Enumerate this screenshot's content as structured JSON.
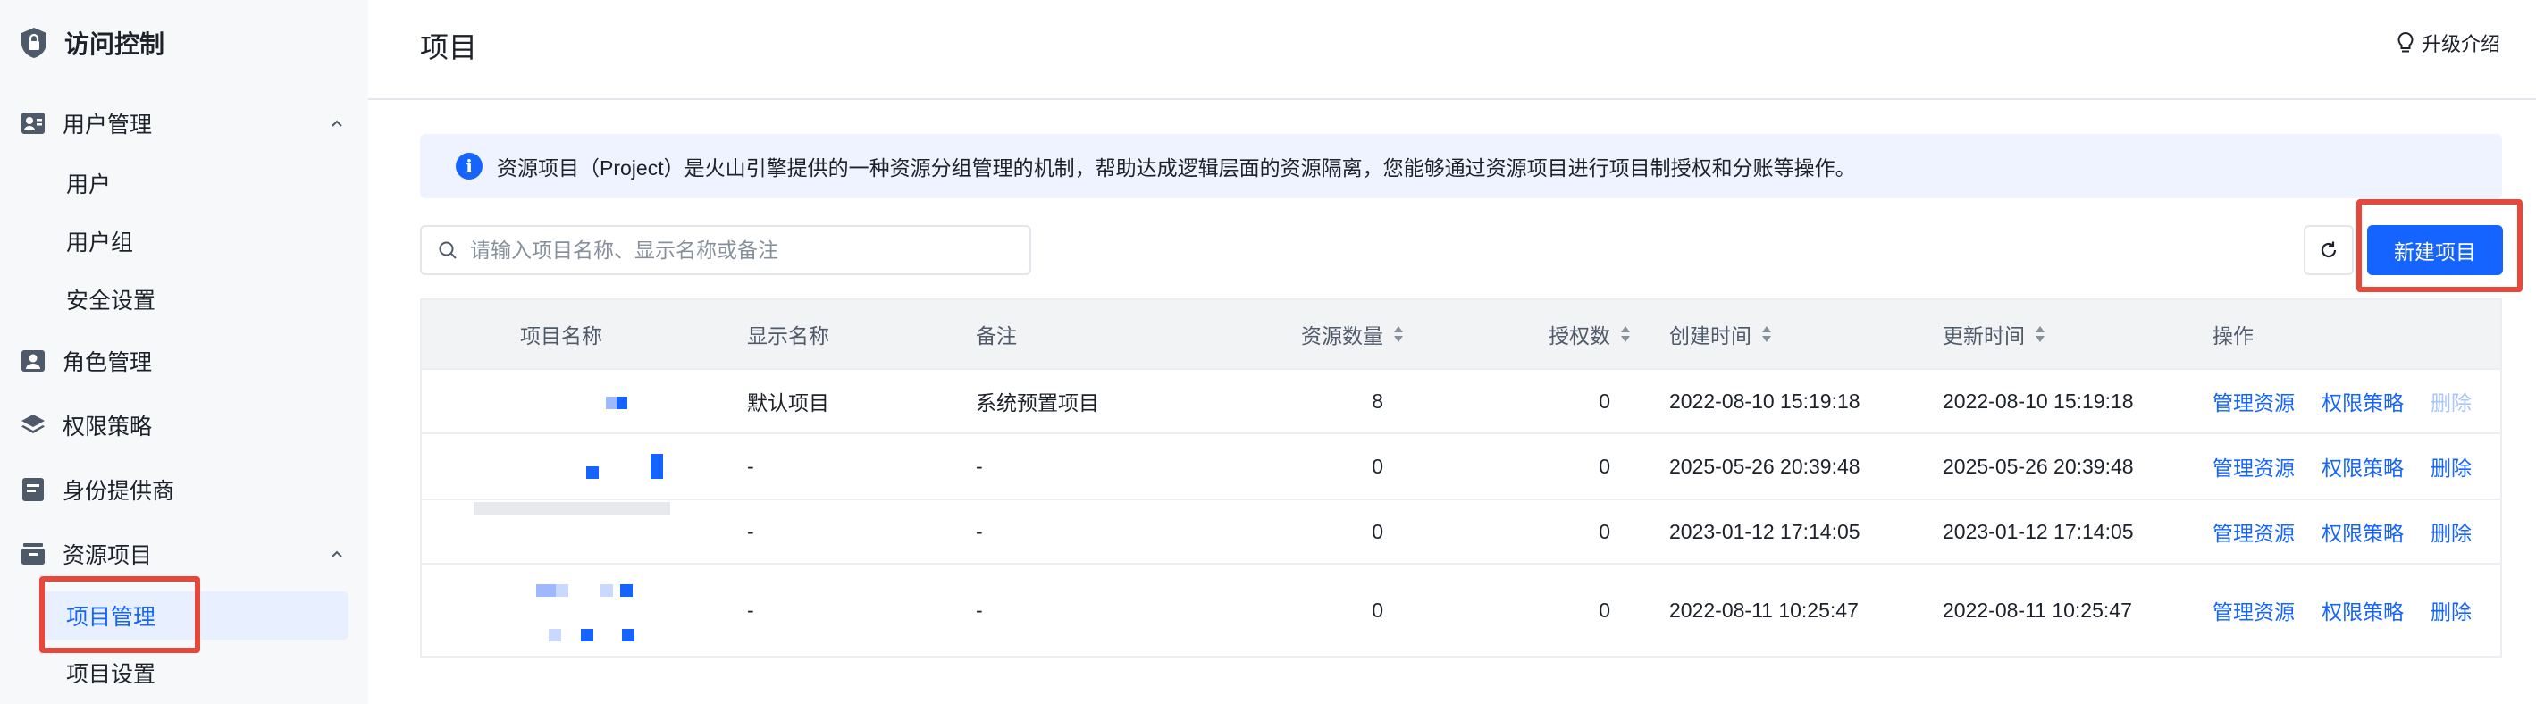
{
  "sidebar": {
    "title": "访问控制",
    "groups": [
      {
        "label": "用户管理",
        "children": [
          "用户",
          "用户组",
          "安全设置"
        ]
      },
      {
        "label": "角色管理"
      },
      {
        "label": "权限策略"
      },
      {
        "label": "身份提供商"
      },
      {
        "label": "资源项目",
        "children": [
          "项目管理",
          "项目设置"
        ]
      }
    ],
    "active_item": "项目管理"
  },
  "header": {
    "title": "项目",
    "upgrade_label": "升级介绍"
  },
  "alert": {
    "text": "资源项目（Project）是火山引擎提供的一种资源分组管理的机制，帮助达成逻辑层面的资源隔离，您能够通过资源项目进行项目制授权和分账等操作。"
  },
  "toolbar": {
    "search_placeholder": "请输入项目名称、显示名称或备注",
    "new_button_label": "新建项目"
  },
  "table": {
    "columns": [
      "项目名称",
      "显示名称",
      "备注",
      "资源数量",
      "授权数",
      "创建时间",
      "更新时间",
      "操作"
    ],
    "rows": [
      {
        "display_name": "默认项目",
        "note": "系统预置项目",
        "resources": "8",
        "auth": "0",
        "created": "2022-08-10 15:19:18",
        "updated": "2022-08-10 15:19:18",
        "actions": [
          "管理资源",
          "权限策略",
          "删除"
        ],
        "delete_disabled": true
      },
      {
        "display_name": "-",
        "note": "-",
        "resources": "0",
        "auth": "0",
        "created": "2025-05-26 20:39:48",
        "updated": "2025-05-26 20:39:48",
        "actions": [
          "管理资源",
          "权限策略",
          "删除"
        ],
        "delete_disabled": false
      },
      {
        "display_name": "-",
        "note": "-",
        "resources": "0",
        "auth": "0",
        "created": "2023-01-12 17:14:05",
        "updated": "2023-01-12 17:14:05",
        "actions": [
          "管理资源",
          "权限策略",
          "删除"
        ],
        "delete_disabled": false
      },
      {
        "display_name": "-",
        "note": "-",
        "resources": "0",
        "auth": "0",
        "created": "2022-08-11 10:25:47",
        "updated": "2022-08-11 10:25:47",
        "actions": [
          "管理资源",
          "权限策略",
          "删除"
        ],
        "delete_disabled": false
      }
    ]
  },
  "colors": {
    "accent": "#1664ff",
    "highlight": "#e8473a",
    "sidebar_bg": "#f7f8fa",
    "active_bg": "#e8efff"
  }
}
